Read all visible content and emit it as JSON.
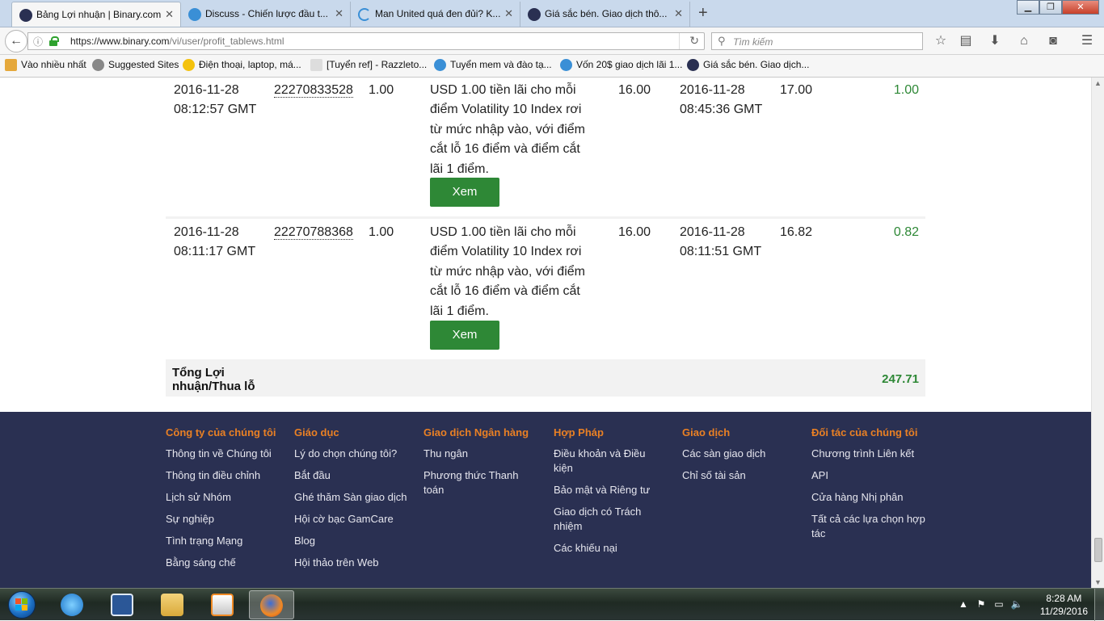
{
  "browser": {
    "tabs": [
      {
        "title": "Bảng Lợi nhuận | Binary.com",
        "active": true
      },
      {
        "title": "Discuss - Chiến lược đầu t..."
      },
      {
        "title": "Man United quá đen đủi? K..."
      },
      {
        "title": "Giá sắc bén. Giao dịch thô..."
      }
    ],
    "url_host": "https://www.binary.com",
    "url_path": "/vi/user/profit_tablews.html",
    "search_placeholder": "Tìm kiếm",
    "bookmarks": [
      "Vào nhiều nhất",
      "Suggested Sites",
      "Điện thoại, laptop, má...",
      "[Tuyển ref] - Razzleto...",
      "Tuyển mem và đào tạ...",
      "Vốn 20$ giao dịch lãi 1...",
      "Giá sắc bén. Giao dịch..."
    ]
  },
  "table": {
    "rows": [
      {
        "purchase_date": "2016-11-28",
        "purchase_time": "08:12:57 GMT",
        "ref": "22270833528",
        "buy_price": "1.00",
        "description": "USD 1.00 tiền lãi cho mỗi điểm Volatility 10 Index rơi từ mức nhập vào, với điểm cắt lỗ 16 điểm và điểm cắt lãi 1 điểm.",
        "barrier_price": "16.00",
        "sale_date": "2016-11-28",
        "sale_time": "08:45:36 GMT",
        "sale_price": "17.00",
        "profit_loss": "1.00",
        "view_label": "Xem"
      },
      {
        "purchase_date": "2016-11-28",
        "purchase_time": "08:11:17 GMT",
        "ref": "22270788368",
        "buy_price": "1.00",
        "description": "USD 1.00 tiền lãi cho mỗi điểm Volatility 10 Index rơi từ mức nhập vào, với điểm cắt lỗ 16 điểm và điểm cắt lãi 1 điểm.",
        "barrier_price": "16.00",
        "sale_date": "2016-11-28",
        "sale_time": "08:11:51 GMT",
        "sale_price": "16.82",
        "profit_loss": "0.82",
        "view_label": "Xem"
      }
    ],
    "total_label": "Tổng Lợi nhuận/Thua lỗ",
    "total_value": "247.71"
  },
  "footer": {
    "columns": [
      {
        "heading": "Công ty của chúng tôi",
        "links": [
          "Thông tin về Chúng tôi",
          "Thông tin điều chỉnh",
          "Lịch sử Nhóm",
          "Sự nghiệp",
          "Tình trạng Mạng",
          "Bằng sáng chế"
        ]
      },
      {
        "heading": "Giáo dục",
        "links": [
          "Lý do chọn chúng tôi?",
          "Bắt đầu",
          "Ghé thăm Sàn giao dịch",
          "Hội cờ bạc GamCare",
          "Blog",
          "Hội thảo trên Web"
        ]
      },
      {
        "heading": "Giao dịch Ngân hàng",
        "links": [
          "Thu ngân",
          "Phương thức Thanh toán"
        ]
      },
      {
        "heading": "Hợp Pháp",
        "links": [
          "Điều khoản và Điều kiện",
          "Bảo mật và Riêng tư",
          "Giao dịch có Trách nhiệm",
          "Các khiếu nại"
        ]
      },
      {
        "heading": "Giao dịch",
        "links": [
          "Các sàn giao dịch",
          "Chỉ số tài sản"
        ]
      },
      {
        "heading": "Đối tác của chúng tôi",
        "links": [
          "Chương trình Liên kết",
          "API",
          "Cửa hàng Nhị phân",
          "Tất cả các lựa chọn hợp tác"
        ]
      }
    ]
  },
  "taskbar": {
    "apps": [
      "internet-explorer-icon",
      "word-icon",
      "explorer-folder-icon",
      "media-player-icon",
      "firefox-icon"
    ],
    "clock_time": "8:28 AM",
    "clock_date": "11/29/2016"
  },
  "colors": {
    "accent_green": "#2e8836",
    "footer_bg": "#2a3052",
    "footer_heading": "#e98024"
  }
}
